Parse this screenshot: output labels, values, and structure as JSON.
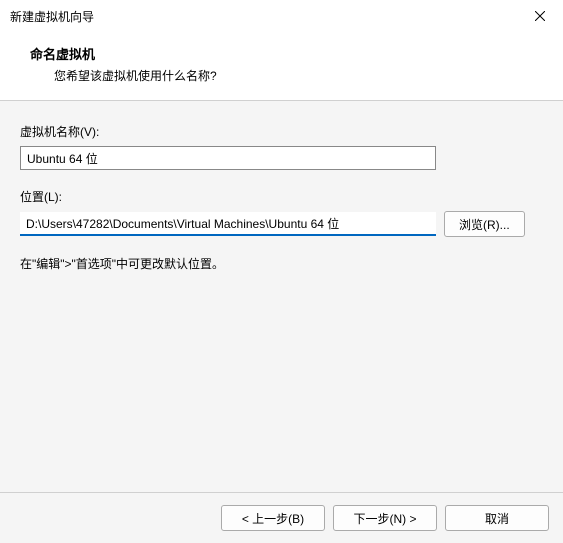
{
  "window": {
    "title": "新建虚拟机向导"
  },
  "header": {
    "title": "命名虚拟机",
    "subtitle": "您希望该虚拟机使用什么名称?"
  },
  "fields": {
    "name_label": "虚拟机名称(V):",
    "name_value": "Ubuntu 64 位",
    "location_label": "位置(L):",
    "location_value": "D:\\Users\\47282\\Documents\\Virtual Machines\\Ubuntu 64 位",
    "browse_label": "浏览(R)..."
  },
  "hint": "在\"编辑\">\"首选项\"中可更改默认位置。",
  "buttons": {
    "back": "< 上一步(B)",
    "next": "下一步(N) >",
    "cancel": "取消"
  }
}
